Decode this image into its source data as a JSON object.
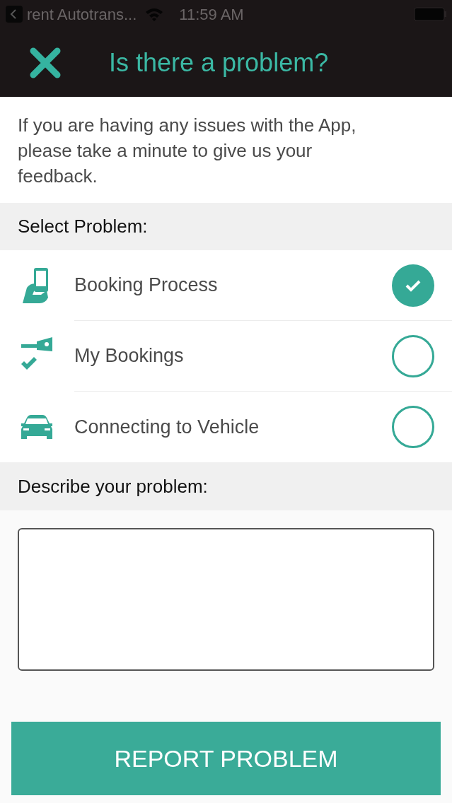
{
  "status_bar": {
    "back_app": "rent Autotrans...",
    "time": "11:59 AM"
  },
  "header": {
    "title": "Is there a problem?"
  },
  "intro": "If you are having any issues with the App, please take a minute to give us your feedback.",
  "select_heading": "Select Problem:",
  "problems": [
    {
      "kind": "phone",
      "label": "Booking Process",
      "selected": true
    },
    {
      "kind": "key",
      "label": "My Bookings",
      "selected": false
    },
    {
      "kind": "car",
      "label": "Connecting to Vehicle",
      "selected": false
    }
  ],
  "describe_heading": "Describe your problem:",
  "submit": "REPORT PROBLEM"
}
